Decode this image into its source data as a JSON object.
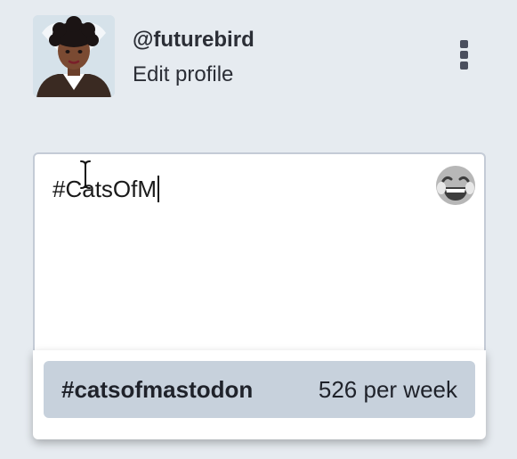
{
  "profile": {
    "handle": "@futurebird",
    "edit_label": "Edit profile",
    "avatar_icon": "user-avatar",
    "menu_icon": "vertical-ellipsis-icon"
  },
  "compose": {
    "text": "#CatsOfM",
    "emoji_icon": "laughing-emoji-icon",
    "cursor_icon": "text-ibeam-cursor"
  },
  "suggestions": [
    {
      "tag": "#catsofmastodon",
      "usage": "526 per week"
    }
  ],
  "colors": {
    "background": "#e6ebf0",
    "panel": "#ffffff",
    "suggestion_highlight": "#c7d1dc",
    "text": "#2b2e36"
  }
}
